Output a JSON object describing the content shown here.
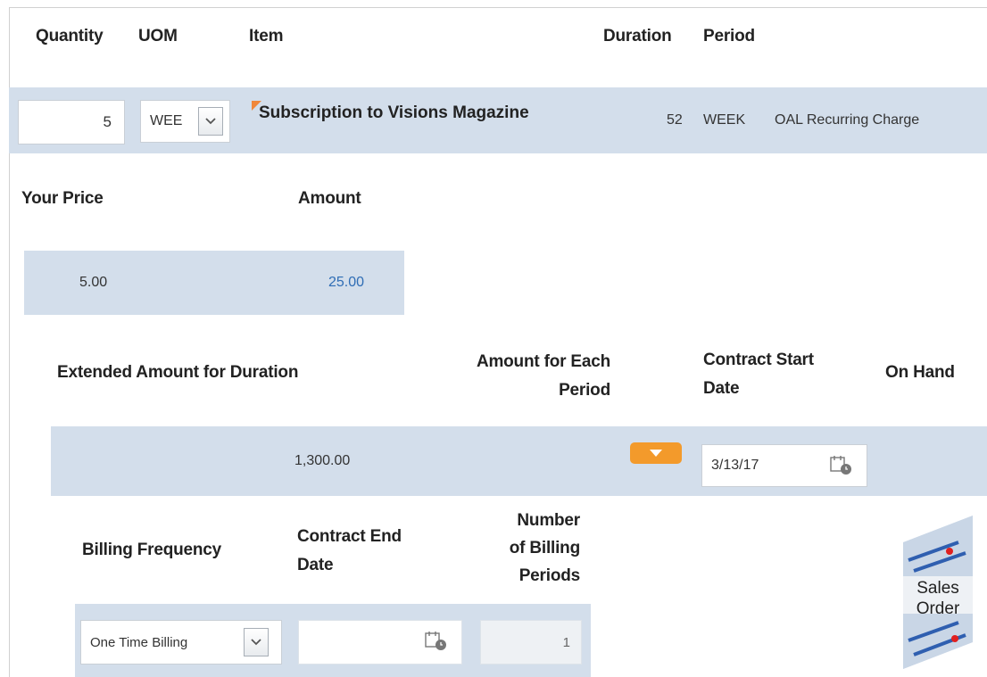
{
  "headers1": {
    "quantity": "Quantity",
    "uom": "UOM",
    "item": "Item",
    "duration": "Duration",
    "period": "Period"
  },
  "row1": {
    "quantity": "5",
    "uom": "WEE",
    "item": "Subscription to Visions Magazine",
    "duration": "52",
    "period": "WEEK",
    "charge": "OAL Recurring Charge"
  },
  "headers2": {
    "your_price": "Your Price",
    "amount": "Amount"
  },
  "row2": {
    "your_price": "5.00",
    "amount": "25.00"
  },
  "headers3": {
    "extended_amount": "Extended Amount for Duration",
    "amount_each_line1": "Amount for Each",
    "amount_each_line2": "Period",
    "contract_start_line1": "Contract Start",
    "contract_start_line2": "Date",
    "on_hand": "On Hand"
  },
  "row3": {
    "extended_amount": "1,300.00",
    "contract_start": "3/13/17"
  },
  "headers4": {
    "billing_frequency": "Billing Frequency",
    "contract_end_line1": "Contract End",
    "contract_end_line2": "Date",
    "num_periods_line1": "Number",
    "num_periods_line2": "of Billing",
    "num_periods_line3": "Periods"
  },
  "row4": {
    "billing_frequency": "One Time Billing",
    "contract_end": "",
    "num_periods": "1"
  },
  "badge": {
    "line1": "Sales",
    "line2": "Order"
  },
  "colors": {
    "band": "#d3deeb",
    "accent_orange": "#f39a2b",
    "link_blue": "#2f6db5"
  },
  "icons": [
    "chevron-down-icon",
    "calendar-icon",
    "triangle-down-icon",
    "flag-icon"
  ]
}
